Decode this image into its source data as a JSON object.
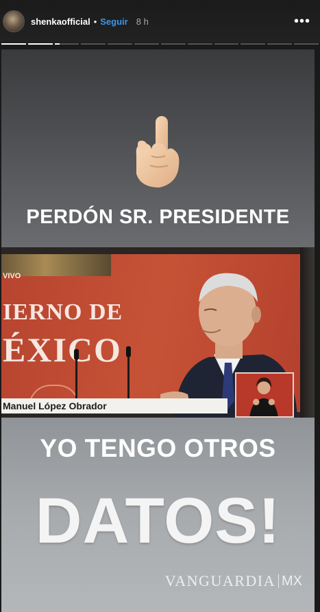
{
  "header": {
    "username": "shenkaofficial",
    "separator": "•",
    "follow_label": "Seguir",
    "time": "8 h",
    "more_icon": "more-horizontal-icon",
    "more_glyph": "•••"
  },
  "progress": {
    "segments": 12,
    "completed": 2,
    "current_fraction": 0.2
  },
  "story": {
    "emoji": "index-pointing-up",
    "caption_top": "PERDÓN SR. PRESIDENTE",
    "caption_middle": "YO TENGO OTROS",
    "caption_big": "DATOS!",
    "photo": {
      "live_label": "VIVO",
      "gov_line1": "IERNO DE",
      "gov_line2": "ÉXICO",
      "name_bar": "Manuel López Obrador"
    },
    "watermark": {
      "name": "VANGUARDIA",
      "suffix": "MX"
    }
  },
  "colors": {
    "follow": "#3897f0",
    "background": "#1a1a1a",
    "screen_red": "#c65236"
  }
}
